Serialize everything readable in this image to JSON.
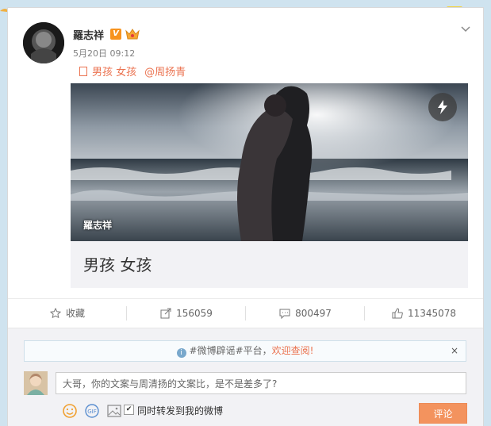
{
  "post": {
    "username": "羅志祥",
    "verified_badge": "V",
    "time": "5月20日 09:12",
    "topic": "男孩 女孩",
    "mention": "@周扬青",
    "media_caption": "羅志祥",
    "media_title": "男孩 女孩"
  },
  "actions": {
    "favorite": "收藏",
    "repost": "156059",
    "comment": "800497",
    "like": "11345078"
  },
  "notice": {
    "text": "#微博辟谣#平台，",
    "link": "欢迎查阅!",
    "close": "×"
  },
  "comment_box": {
    "value": "大哥，你的文案与周清扬的文案比，是不是差多了?",
    "also_repost": "同时转发到我的微博",
    "submit": "评论",
    "also_repost_checked": true
  },
  "colors": {
    "accent": "#eb7350",
    "button": "#f3935e",
    "background": "#cfe3ef"
  },
  "icons": [
    "chevron-down-icon",
    "flash-icon",
    "star-icon",
    "repost-icon",
    "comment-icon",
    "like-icon",
    "info-icon",
    "emoji-icon",
    "gif-icon",
    "image-icon"
  ]
}
